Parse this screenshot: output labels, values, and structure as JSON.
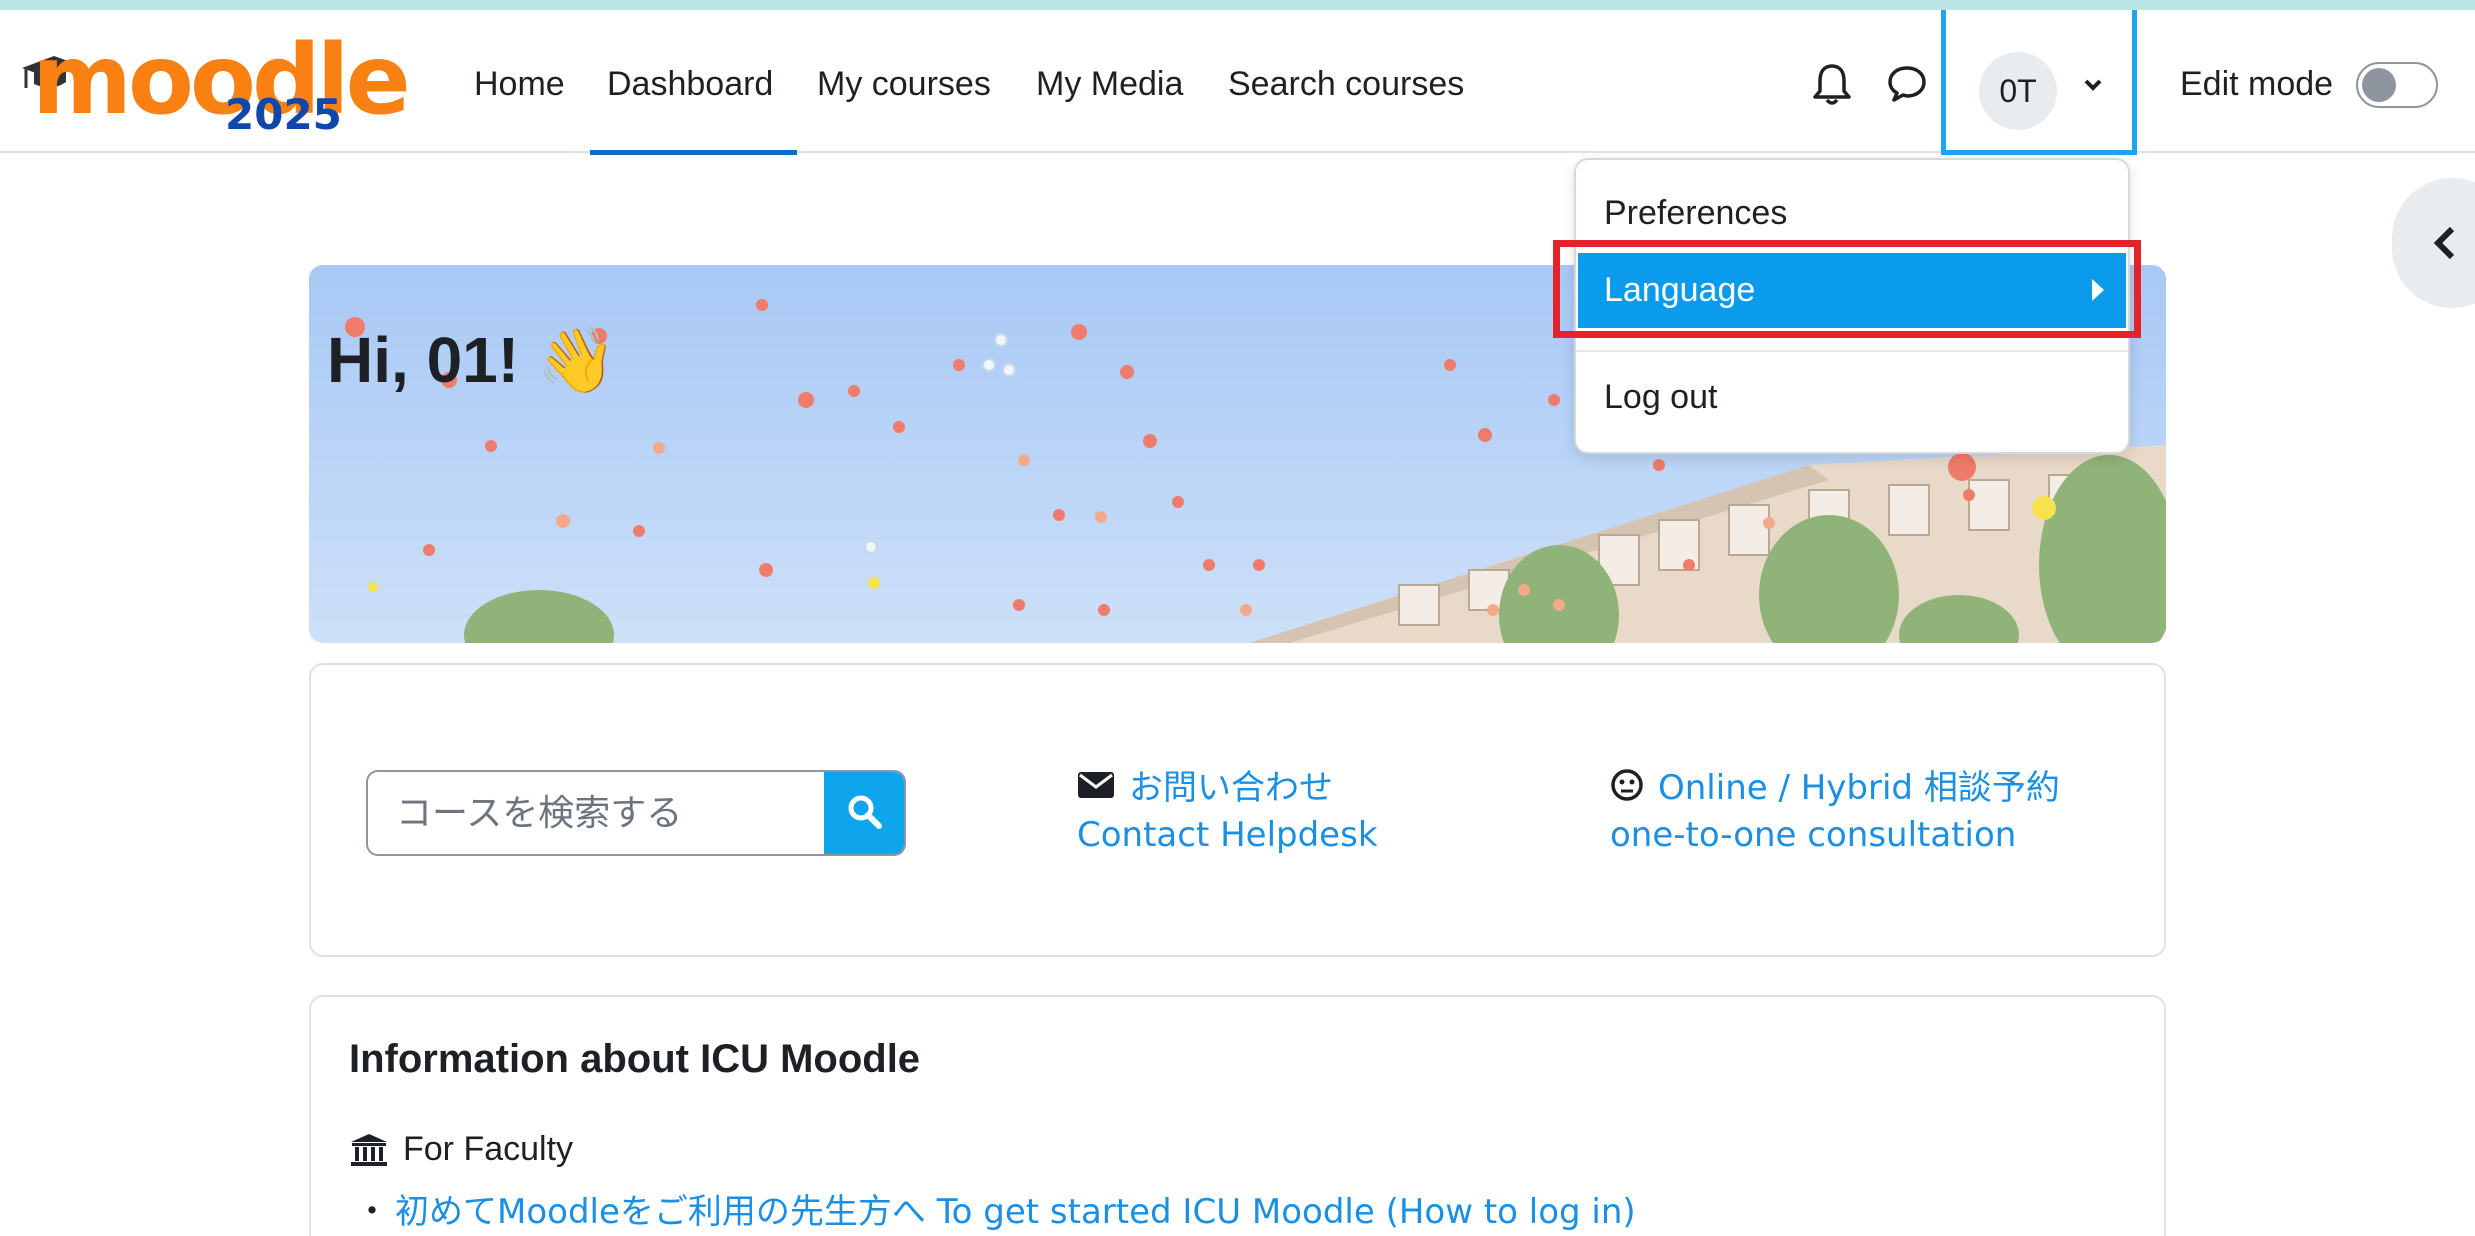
{
  "brand": {
    "logo_word": "moodle",
    "logo_year": "2025",
    "colors": {
      "logo_orange": "#f98012",
      "logo_blue": "#0f47ad",
      "accent": "#0f6cbf",
      "link": "#1a8fe3",
      "highlight": "#e1242a"
    }
  },
  "nav": {
    "items": [
      {
        "label": "Home"
      },
      {
        "label": "Dashboard",
        "active": true
      },
      {
        "label": "My courses"
      },
      {
        "label": "My Media"
      },
      {
        "label": "Search courses"
      }
    ]
  },
  "header_right": {
    "notifications_icon": "bell-icon",
    "messages_icon": "chat-bubble-icon",
    "user_initials": "0T",
    "user_menu_icon": "chevron-down-icon",
    "edit_mode_label": "Edit mode",
    "edit_mode_on": false
  },
  "user_dropdown": {
    "items": [
      {
        "label": "Preferences"
      },
      {
        "label": "Language",
        "has_submenu": true,
        "selected": true
      },
      {
        "label": "Log out"
      }
    ]
  },
  "drawer_toggle_icon": "chevron-left-icon",
  "banner": {
    "greeting": "Hi, 01! 👋"
  },
  "quick_links": {
    "search_placeholder": "コースを検索する",
    "search_icon": "search-icon",
    "contact": {
      "icon": "envelope-icon",
      "line1": "お問い合わせ",
      "line2": "Contact  Helpdesk"
    },
    "consultation": {
      "icon": "smile-face-icon",
      "line1": "Online / Hybrid 相談予約",
      "line2": "one-to-one consultation"
    }
  },
  "info": {
    "title": "Information about ICU Moodle",
    "faculty_icon": "institution-icon",
    "faculty_label": "For Faculty",
    "bullet": "・",
    "getting_started_link": "初めてMoodleをご利用の先生方へ To get started ICU Moodle (How to log in)"
  }
}
